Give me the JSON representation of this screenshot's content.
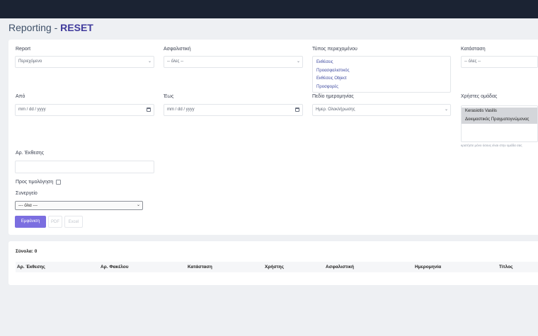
{
  "header": {
    "title_prefix": "Reporting - ",
    "title_accent": "RESET"
  },
  "filters": {
    "report": {
      "label": "Report",
      "value": "Περιεχόμενο"
    },
    "insurer": {
      "label": "Ασφαλιστική",
      "value": "-- όλες --"
    },
    "content_type": {
      "label": "Τύπος περιεχομένου",
      "options": [
        "Εκθέσεις",
        "Προασφαλιστικός",
        "Εκθέσεις Object",
        "Προσφορές"
      ]
    },
    "status": {
      "label": "Κατάσταση",
      "value": "-- όλες --"
    },
    "from": {
      "label": "Από",
      "placeholder": "mm / dd / yyyy"
    },
    "to": {
      "label": "Έως",
      "placeholder": "mm / dd / yyyy"
    },
    "date_field": {
      "label": "Πεδίο ημερομηνίας",
      "value": "Ημερ. Ολοκλήρωσης"
    },
    "group_users": {
      "label": "Χρήστες ομάδας",
      "options": [
        "Kerasiotis Vasilis",
        "Δοκιμαστικός Πραγματογνώμονας"
      ],
      "hint": "κρατήστε μόνο όσους είναι στην ομάδα σας"
    },
    "report_no": {
      "label": "Αρ. Έκθεσης",
      "value": ""
    },
    "invoicing": {
      "label": "Προς τιμολόγηση"
    },
    "partner": {
      "label": "Συνεργείο",
      "value": "--- όλα ---"
    },
    "buttons": {
      "show": "Εμφάνιση",
      "pdf": "PDF",
      "excel": "Excel"
    }
  },
  "results": {
    "totals": "Σύνολα: 0",
    "columns": [
      "Αρ. Έκθεσης",
      "Αρ. Φακέλου",
      "Κατάσταση",
      "Χρήστης",
      "Ασφαλιστική",
      "Ημερομηνία",
      "Τίτλος"
    ]
  }
}
